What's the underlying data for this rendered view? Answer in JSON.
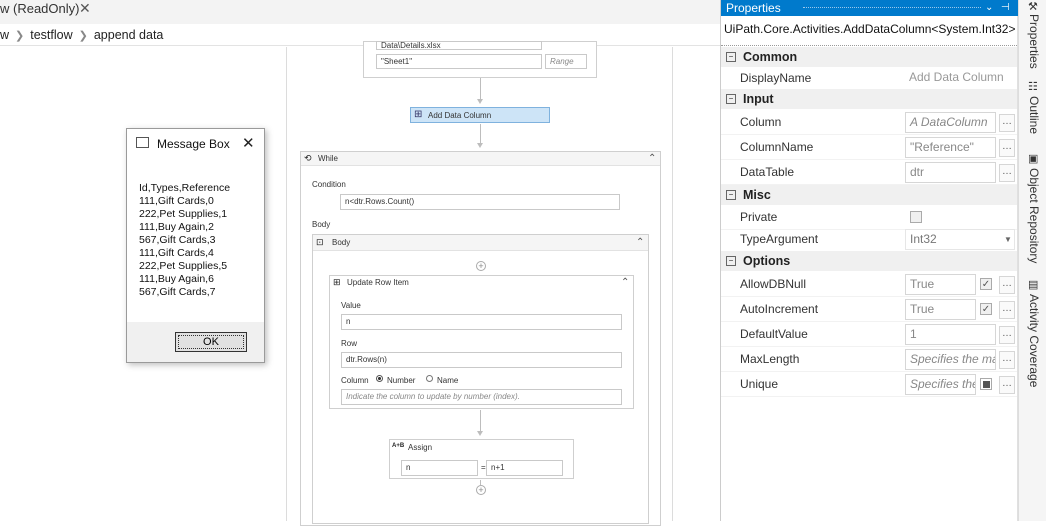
{
  "tab": {
    "title": "w (ReadOnly)"
  },
  "breadcrumb": [
    "w",
    "testflow",
    "append data"
  ],
  "designer": {
    "read_range": {
      "file": "Data\\Details.xlsx",
      "sheet": "\"Sheet1\"",
      "range_placeholder": "Range"
    },
    "add_data_column": {
      "title": "Add Data Column"
    },
    "while": {
      "title": "While",
      "condition_label": "Condition",
      "condition": "n<dtr.Rows.Count()",
      "body_label": "Body",
      "body_title": "Body",
      "update_row": {
        "title": "Update Row Item",
        "value_label": "Value",
        "value": "n",
        "row_label": "Row",
        "row": "dtr.Rows(n)",
        "column_label": "Column",
        "opt_number": "Number",
        "opt_name": "Name",
        "column_placeholder": "Indicate the column to update by number (index)."
      },
      "assign": {
        "title": "Assign",
        "icon_text": "A+B",
        "to": "n",
        "eq": "=",
        "value": "n+1"
      }
    }
  },
  "message_box": {
    "title": "Message Box",
    "lines": [
      "Id,Types,Reference",
      "111,Gift Cards,0",
      "222,Pet Supplies,1",
      "111,Buy Again,2",
      "567,Gift Cards,3",
      "111,Gift Cards,4",
      "222,Pet Supplies,5",
      "111,Buy Again,6",
      "567,Gift Cards,7"
    ],
    "ok_label": "OK"
  },
  "properties": {
    "header": "Properties",
    "type_name": "UiPath.Core.Activities.AddDataColumn<System.Int32>",
    "categories": {
      "common": "Common",
      "input": "Input",
      "misc": "Misc",
      "options": "Options"
    },
    "rows": {
      "display_name": {
        "name": "DisplayName",
        "value": "Add Data Column"
      },
      "column": {
        "name": "Column",
        "value": "A DataColumn"
      },
      "column_name": {
        "name": "ColumnName",
        "value": "\"Reference\""
      },
      "data_table": {
        "name": "DataTable",
        "value": "dtr"
      },
      "private": {
        "name": "Private"
      },
      "type_argument": {
        "name": "TypeArgument",
        "value": "Int32"
      },
      "allow_db_null": {
        "name": "AllowDBNull",
        "value": "True"
      },
      "auto_increment": {
        "name": "AutoIncrement",
        "value": "True"
      },
      "default_value": {
        "name": "DefaultValue",
        "value": "1"
      },
      "max_length": {
        "name": "MaxLength",
        "value": "Specifies the max"
      },
      "unique": {
        "name": "Unique",
        "value": "Specifies the"
      }
    }
  },
  "side_tabs": [
    "Properties",
    "Outline",
    "Object Repository",
    "Activity Coverage"
  ],
  "colors": {
    "accent": "#007acc",
    "selected_activity": "#cde4f7"
  }
}
